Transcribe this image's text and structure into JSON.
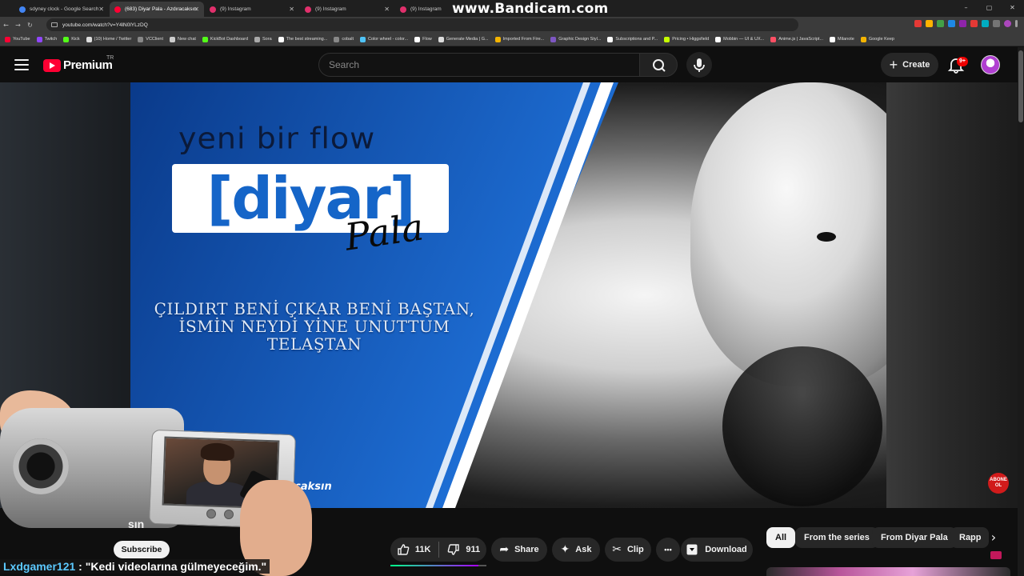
{
  "browser": {
    "tabs": [
      {
        "label": "sdyney clock - Google Search",
        "color": "#4285f4",
        "active": false
      },
      {
        "label": "(683) Diyar Pala - Azdıracaksın",
        "color": "#ff0033",
        "active": true
      },
      {
        "label": "(9) Instagram",
        "color": "#e1306c",
        "active": false
      },
      {
        "label": "(9) Instagram",
        "color": "#e1306c",
        "active": false
      },
      {
        "label": "(9) Instagram",
        "color": "#e1306c",
        "active": false
      }
    ],
    "watermark": "www.Bandicam.com",
    "url": "youtube.com/watch?v=Y4lN0lYLzDQ",
    "bookmarks": [
      {
        "label": "YouTube",
        "color": "#ff0033"
      },
      {
        "label": "Twitch",
        "color": "#9146ff"
      },
      {
        "label": "Kick",
        "color": "#53fc18"
      },
      {
        "label": "(10) Home / Twitter",
        "color": "#dddddd"
      },
      {
        "label": "VCClient",
        "color": "#888888"
      },
      {
        "label": "New chat",
        "color": "#cccccc"
      },
      {
        "label": "KickBot Dashboard",
        "color": "#53fc18"
      },
      {
        "label": "Sora",
        "color": "#aaaaaa"
      },
      {
        "label": "The best streaming...",
        "color": "#ffffff"
      },
      {
        "label": "cobalt",
        "color": "#888888"
      },
      {
        "label": "Color wheel - color...",
        "color": "#4fc3f7"
      },
      {
        "label": "Flow",
        "color": "#ffffff"
      },
      {
        "label": "Generate Media | G...",
        "color": "#dddddd"
      },
      {
        "label": "Imported From Fire...",
        "color": "#f4b400"
      },
      {
        "label": "Graphic Design Styl...",
        "color": "#7e57c2"
      },
      {
        "label": "Subscriptions and P...",
        "color": "#ffffff"
      },
      {
        "label": "Pricing • Higgsfield",
        "color": "#c6ff00"
      },
      {
        "label": "Mobbin — UI & UX...",
        "color": "#ffffff"
      },
      {
        "label": "Anime.js | JavaScript...",
        "color": "#ff4f64"
      },
      {
        "label": "Milanote",
        "color": "#ffffff"
      },
      {
        "label": "Google Keep",
        "color": "#f4b400"
      }
    ]
  },
  "youtube": {
    "logo_word": "Premium",
    "country_code": "TR",
    "search_placeholder": "Search",
    "create_label": "Create",
    "notification_badge": "9+"
  },
  "video": {
    "yeni_text": "yeni bir flow",
    "logo_text": "[diyar]",
    "signature": "Pala",
    "lyrics": [
      "ÇILDIRT BENİ ÇIKAR BENİ BAŞTAN,",
      "İSMİN NEYDİ YİNE UNUTTUM",
      "TELAŞTAN"
    ],
    "cut_text": "racaksın",
    "abone_badge": [
      "ABONE",
      "OL"
    ]
  },
  "below": {
    "title_fragment": "sın",
    "subscribe_label": "Subscribe",
    "chat_user": "Lxdgamer121",
    "chat_message": " : \"Kedi videolarına gülmeyeceğim.\"",
    "likes": "11K",
    "dislikes": "911",
    "like_ratio": 0.92,
    "share_label": "Share",
    "ask_label": "Ask",
    "clip_label": "Clip",
    "more_label": "•••",
    "download_label": "Download",
    "chips": [
      "All",
      "From the series",
      "From Diyar Pala",
      "Rapp"
    ]
  }
}
